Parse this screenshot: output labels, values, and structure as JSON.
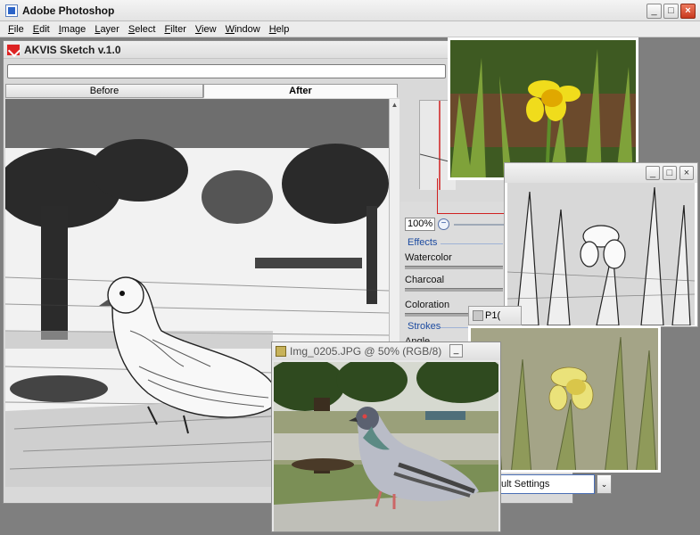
{
  "app": {
    "title": "Adobe Photoshop",
    "window_buttons": {
      "minimize": "_",
      "maximize": "□",
      "close": "×"
    }
  },
  "menu": [
    "File",
    "Edit",
    "Image",
    "Layer",
    "Select",
    "Filter",
    "View",
    "Window",
    "Help"
  ],
  "plugin": {
    "title": "AKVIS Sketch v.1.0",
    "tabs": {
      "before": "Before",
      "after": "After"
    }
  },
  "settings": {
    "zoom": "100%",
    "zoom_minus": "−",
    "effects_header": "Effects",
    "watercolor": "Watercolor",
    "charcoal": "Charcoal",
    "coloration": "Coloration",
    "strokes_header": "Strokes",
    "angle": "Angle",
    "preset": "ult Settings",
    "dropdown_arrow": "⌄"
  },
  "documents": {
    "pigeon_title": "Img_0205.JPG @ 50% (RGB/8)",
    "pigeon_min": "_",
    "p1_tab": "P1("
  },
  "colors": {
    "workspace": "#7f7f7f",
    "accent_blue": "#1d4ba0",
    "close_red": "#c83a1f",
    "flower_yellow": "#f0dc1c"
  }
}
